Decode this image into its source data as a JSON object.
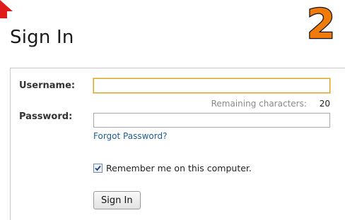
{
  "badge": {
    "step_number": "2"
  },
  "page": {
    "title": "Sign In"
  },
  "form": {
    "username_label": "Username:",
    "username_value": "",
    "remaining_label": "Remaining characters:",
    "remaining_count": "20",
    "password_label": "Password:",
    "password_value": "",
    "forgot_link": "Forgot Password?",
    "remember_checked": true,
    "remember_label": "Remember me on this computer.",
    "signin_button": "Sign In"
  },
  "colors": {
    "badge_fill": "#f07a0a",
    "arrow": "#e01b1b",
    "link": "#1f5d96",
    "focus_border": "#d8a52a"
  },
  "icons": {
    "arrow": "arrow-icon",
    "checkbox": "checkbox-icon"
  }
}
